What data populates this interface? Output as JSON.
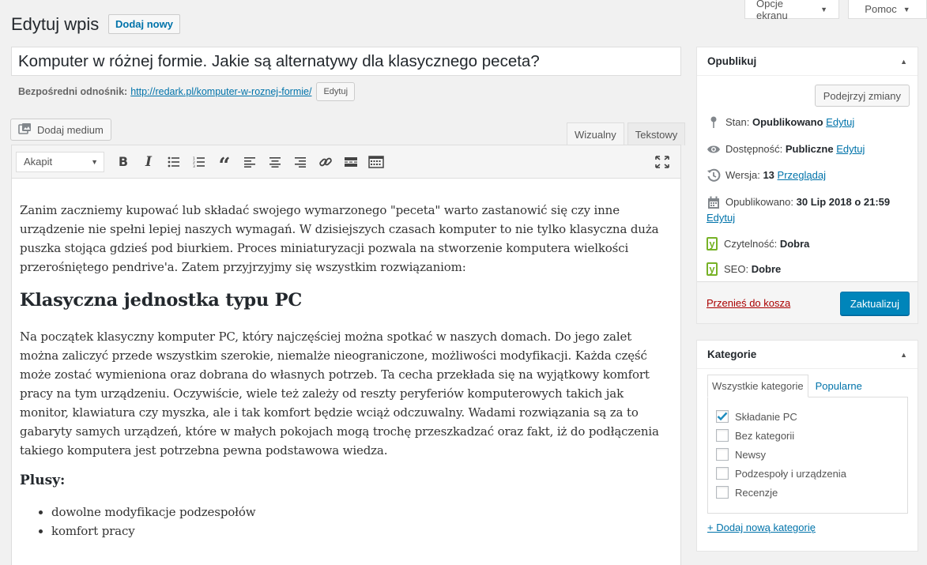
{
  "screen": {
    "options_label": "Opcje ekranu",
    "help_label": "Pomoc"
  },
  "header": {
    "title": "Edytuj wpis",
    "add_new": "Dodaj nowy"
  },
  "post": {
    "title": "Komputer w różnej formie. Jakie są alternatywy dla klasycznego peceta?",
    "permalink_label": "Bezpośredni odnośnik:",
    "permalink_base": "http://redark.pl/",
    "permalink_slug": "komputer-w-roznej-formie",
    "permalink_end": "/",
    "permalink_edit": "Edytuj"
  },
  "editor": {
    "add_media": "Dodaj medium",
    "tab_visual": "Wizualny",
    "tab_text": "Tekstowy",
    "format_select": "Akapit",
    "toolbar_icons": [
      "bold-icon",
      "italic-icon",
      "bullet-list-icon",
      "numbered-list-icon",
      "blockquote-icon",
      "align-left-icon",
      "align-center-icon",
      "align-right-icon",
      "link-icon",
      "read-more-icon",
      "toolbar-toggle-icon",
      "fullscreen-icon"
    ]
  },
  "content": {
    "p1": "Zanim zaczniemy kupować lub składać swojego wymarzonego \"peceta\" warto zastanowić się czy inne urządzenie nie spełni lepiej naszych wymagań. W dzisiejszych czasach komputer to nie tylko klasyczna duża puszka stojąca gdzieś pod biurkiem. Proces miniaturyzacji pozwala na stworzenie komputera wielkości przerośniętego pendrive'a. Zatem przyjrzyjmy się wszystkim rozwiązaniom:",
    "h2": "Klasyczna jednostka typu PC",
    "p2": "Na początek klasyczny komputer PC, który najczęściej można spotkać w naszych domach. Do jego zalet można zaliczyć przede wszystkim szerokie, niemalże nieograniczone, możliwości modyfikacji. Każda część może zostać wymieniona oraz dobrana do własnych potrzeb. Ta cecha przekłada się na wyjątkowy komfort pracy na tym urządzeniu. Oczywiście, wiele też zależy od reszty peryferiów komputerowych takich jak monitor, klawiatura czy myszka, ale i tak komfort będzie wciąż odczuwalny. Wadami rozwiązania są za to gabaryty samych urządzeń, które w małych pokojach mogą trochę przeszkadzać oraz fakt, iż do podłączenia takiego komputera jest potrzebna pewna podstawowa wiedza.",
    "h3": "Plusy:",
    "list": [
      "dowolne modyfikacje podzespołów",
      "komfort pracy"
    ]
  },
  "publish": {
    "title": "Opublikuj",
    "preview": "Podejrzyj zmiany",
    "status_label": "Stan:",
    "status_value": "Opublikowano",
    "status_edit": "Edytuj",
    "visibility_label": "Dostępność:",
    "visibility_value": "Publiczne",
    "visibility_edit": "Edytuj",
    "revisions_label": "Wersja:",
    "revisions_value": "13",
    "revisions_link": "Przeglądaj",
    "published_label": "Opublikowano:",
    "published_value": "30 Lip 2018 o 21:59",
    "published_edit": "Edytuj",
    "readability_label": "Czytelność:",
    "readability_value": "Dobra",
    "seo_label": "SEO:",
    "seo_value": "Dobre",
    "trash": "Przenieś do kosza",
    "update": "Zaktualizuj"
  },
  "categories": {
    "title": "Kategorie",
    "tab_all": "Wszystkie kategorie",
    "tab_popular": "Popularne",
    "items": [
      {
        "label": "Składanie PC",
        "checked": true
      },
      {
        "label": "Bez kategorii",
        "checked": false
      },
      {
        "label": "Newsy",
        "checked": false
      },
      {
        "label": "Podzespoły i urządzenia",
        "checked": false
      },
      {
        "label": "Recenzje",
        "checked": false
      }
    ],
    "add_new": "+ Dodaj nową kategorię"
  },
  "colors": {
    "primary": "#0085ba",
    "link": "#0073aa",
    "danger": "#a00",
    "yoast": "#77b227"
  }
}
